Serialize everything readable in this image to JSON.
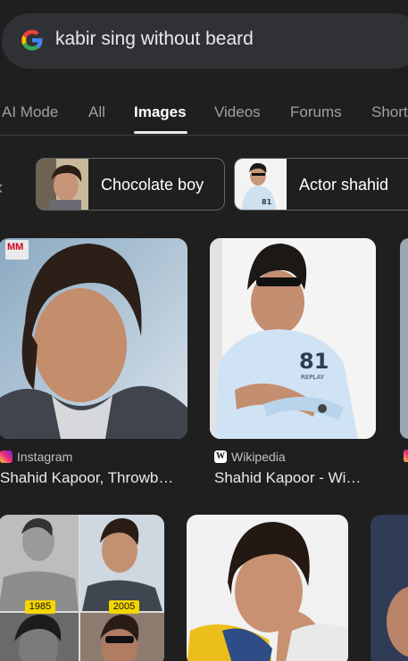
{
  "search": {
    "query": "kabir sing without beard"
  },
  "tabs": [
    {
      "label": "AI Mode"
    },
    {
      "label": "All"
    },
    {
      "label": "Images"
    },
    {
      "label": "Videos"
    },
    {
      "label": "Forums"
    },
    {
      "label": "Short"
    }
  ],
  "chips": [
    {
      "label": "Chocolate boy"
    },
    {
      "label": "Actor shahid"
    }
  ],
  "results": [
    {
      "source": "Instagram",
      "title": "Shahid Kapoor, Throwb…"
    },
    {
      "source": "Wikipedia",
      "title": "Shahid Kapoor - Wi…"
    },
    {
      "badge_left": "1985",
      "badge_right": "2005"
    }
  ],
  "overlay": {
    "mm_logo": "MM"
  },
  "colors": {
    "background": "#1f1f1f",
    "searchbar": "#303134",
    "badge": "#f4d600"
  }
}
